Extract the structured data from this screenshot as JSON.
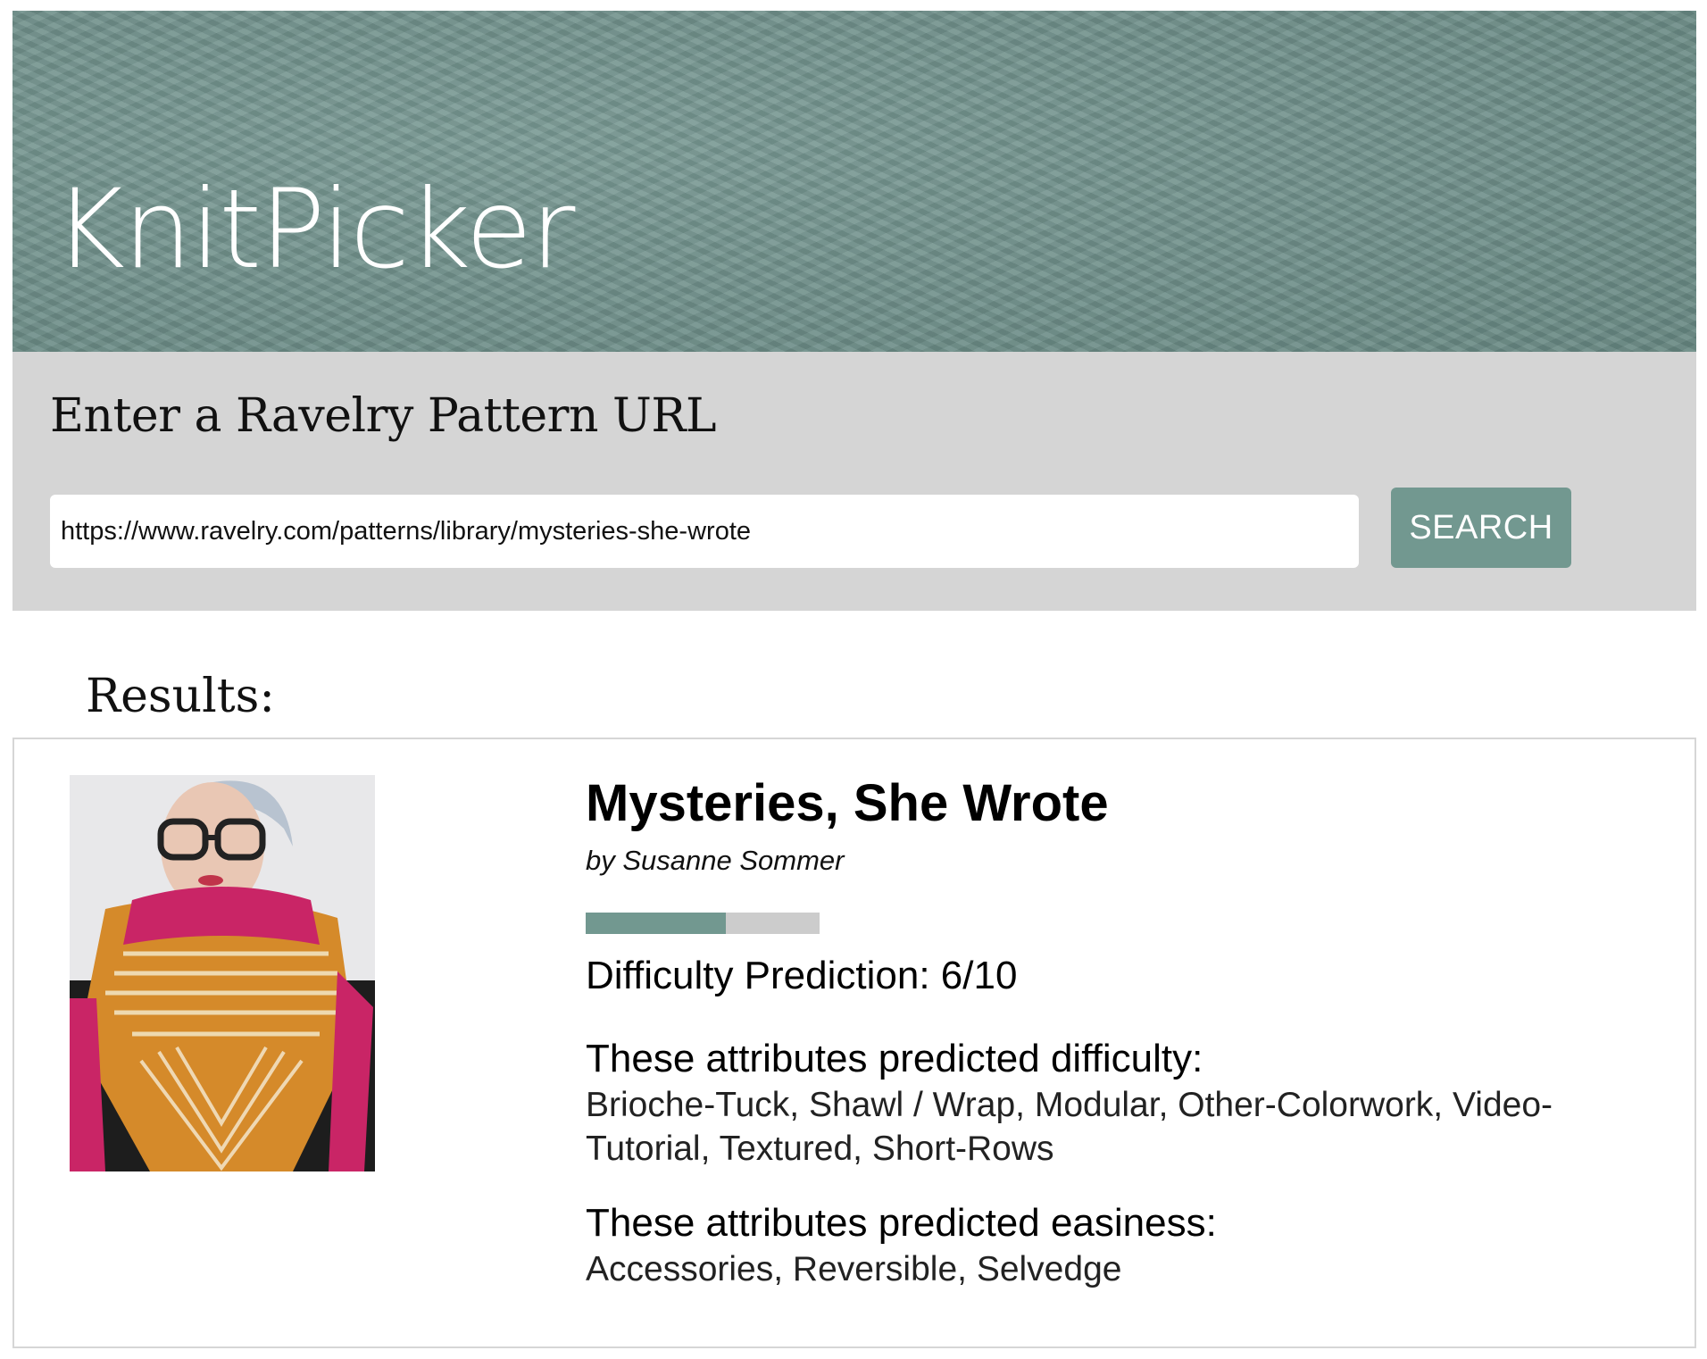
{
  "app": {
    "brand": "KnitPicker"
  },
  "search": {
    "heading": "Enter a Ravelry Pattern URL",
    "url_value": "https://www.ravelry.com/patterns/library/mysteries-she-wrote",
    "button_label": "SEARCH"
  },
  "results": {
    "label": "Results:",
    "pattern": {
      "title": "Mysteries, She Wrote",
      "author": "by Susanne Sommer",
      "difficulty_value": 6,
      "difficulty_max": 10,
      "difficulty_text": "Difficulty Prediction: 6/10",
      "difficulty_attrs_heading": "These attributes predicted difficulty:",
      "difficulty_attrs": "Brioche-Tuck, Shawl / Wrap, Modular, Other-Colorwork, Video-Tutorial, Textured, Short-Rows",
      "easiness_attrs_heading": "These attributes predicted easiness:",
      "easiness_attrs": "Accessories, Reversible, Selvedge"
    }
  },
  "colors": {
    "accent": "#729890",
    "panel": "#d5d5d5",
    "bar_track": "#cccccc"
  }
}
